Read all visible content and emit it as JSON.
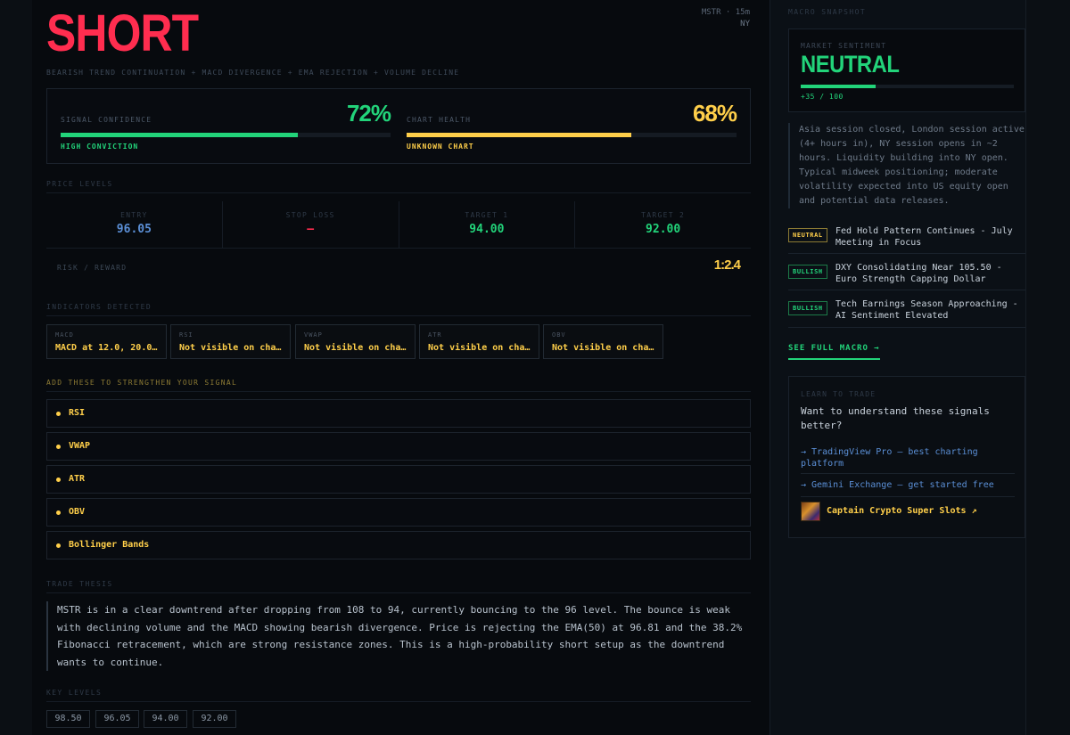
{
  "signal": {
    "direction": "SHORT",
    "ticker": "MSTR · 15m",
    "session": "NY",
    "subtitle": "BEARISH TREND CONTINUATION + MACD DIVERGENCE + EMA REJECTION + VOLUME DECLINE"
  },
  "confidence": {
    "label": "SIGNAL CONFIDENCE",
    "value": "72%",
    "fraction": 0.72,
    "sub": "HIGH CONVICTION",
    "color": "#22d47a"
  },
  "health": {
    "label": "CHART HEALTH",
    "value": "68%",
    "fraction": 0.68,
    "sub": "UNKNOWN CHART",
    "color": "#ffcf4a"
  },
  "price_levels": {
    "title": "PRICE LEVELS",
    "items": [
      {
        "key": "ENTRY",
        "value": "96.05",
        "color": "#5b8fd6"
      },
      {
        "key": "STOP LOSS",
        "value": "—",
        "color": "#ff2d4f"
      },
      {
        "key": "TARGET 1",
        "value": "94.00",
        "color": "#22d47a"
      },
      {
        "key": "TARGET 2",
        "value": "92.00",
        "color": "#22d47a"
      }
    ],
    "rr_label": "RISK / REWARD",
    "rr_value": "1:2.4"
  },
  "indicators": {
    "title": "INDICATORS DETECTED",
    "items": [
      {
        "key": "MACD",
        "value": "MACD at 12.0, 20.0..."
      },
      {
        "key": "RSI",
        "value": "Not visible on chart"
      },
      {
        "key": "VWAP",
        "value": "Not visible on chart"
      },
      {
        "key": "ATR",
        "value": "Not visible on chart"
      },
      {
        "key": "OBV",
        "value": "Not visible on chart"
      }
    ]
  },
  "strengthen": {
    "title": "ADD THESE TO STRENGTHEN YOUR SIGNAL",
    "items": [
      "RSI",
      "VWAP",
      "ATR",
      "OBV",
      "Bollinger Bands"
    ]
  },
  "thesis": {
    "title": "TRADE THESIS",
    "text": "MSTR is in a clear downtrend after dropping from 108 to 94, currently bouncing to the 96 level. The bounce is weak with declining volume and the MACD showing bearish divergence. Price is rejecting the EMA(50) at 96.81 and the 38.2% Fibonacci retracement, which are strong resistance zones. This is a high-probability short setup as the downtrend wants to continue."
  },
  "key_levels": {
    "title": "KEY LEVELS",
    "items": [
      "98.50",
      "96.05",
      "94.00",
      "92.00"
    ]
  },
  "macro": {
    "title": "MACRO SNAPSHOT",
    "sentiment_label": "MARKET SENTIMENT",
    "sentiment_value": "NEUTRAL",
    "score_text": "+35 / 100",
    "score_fraction": 0.35,
    "summary": "Asia session closed, London session active (4+ hours in), NY session opens in ~2 hours. Liquidity building into NY open. Typical midweek positioning; moderate volatility expected into US equity open and potential data releases.",
    "news": [
      {
        "badge": "NEUTRAL",
        "color": "#ffcf4a",
        "title": "Fed Hold Pattern Continues - July Meeting in Focus"
      },
      {
        "badge": "BULLISH",
        "color": "#22d47a",
        "title": "DXY Consolidating Near 105.50 - Euro Strength Capping Dollar"
      },
      {
        "badge": "BULLISH",
        "color": "#22d47a",
        "title": "Tech Earnings Season Approaching - AI Sentiment Elevated"
      }
    ],
    "see_full": "SEE FULL MACRO →"
  },
  "learn": {
    "title": "LEARN TO TRADE",
    "question": "Want to understand these signals better?",
    "links": [
      "→ TradingView Pro — best charting platform",
      "→ Gemini Exchange — get started free"
    ],
    "promo": "Captain Crypto Super Slots ↗"
  }
}
